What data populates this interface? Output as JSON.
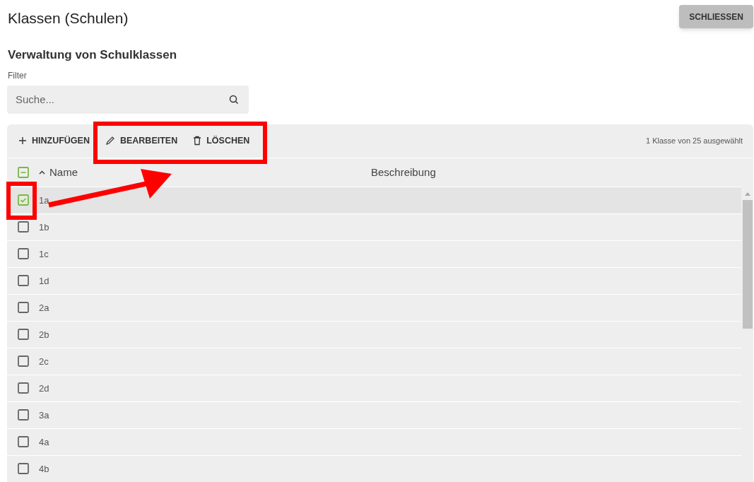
{
  "page_title": "Klassen (Schulen)",
  "close_button": "SCHLIESSEN",
  "section_title": "Verwaltung von Schulklassen",
  "filter": {
    "label": "Filter",
    "placeholder": "Suche..."
  },
  "toolbar": {
    "actions": [
      {
        "label": "HINZUFÜGEN",
        "kind": "add"
      },
      {
        "label": "BEARBEITEN",
        "kind": "edit"
      },
      {
        "label": "LÖSCHEN",
        "kind": "delete"
      }
    ],
    "selection_info": "1 Klasse von 25 ausgewählt"
  },
  "table": {
    "select_all_indeterminate": true,
    "columns": [
      {
        "label": "Name",
        "sorted_ascending": true
      },
      {
        "label": "Beschreibung",
        "sorted_ascending": false
      }
    ],
    "rows": [
      {
        "name": "1a",
        "checked": true
      },
      {
        "name": "1b",
        "checked": false
      },
      {
        "name": "1c",
        "checked": false
      },
      {
        "name": "1d",
        "checked": false
      },
      {
        "name": "2a",
        "checked": false
      },
      {
        "name": "2b",
        "checked": false
      },
      {
        "name": "2c",
        "checked": false
      },
      {
        "name": "2d",
        "checked": false
      },
      {
        "name": "3a",
        "checked": false
      },
      {
        "name": "4a",
        "checked": false
      },
      {
        "name": "4b",
        "checked": false
      }
    ]
  }
}
